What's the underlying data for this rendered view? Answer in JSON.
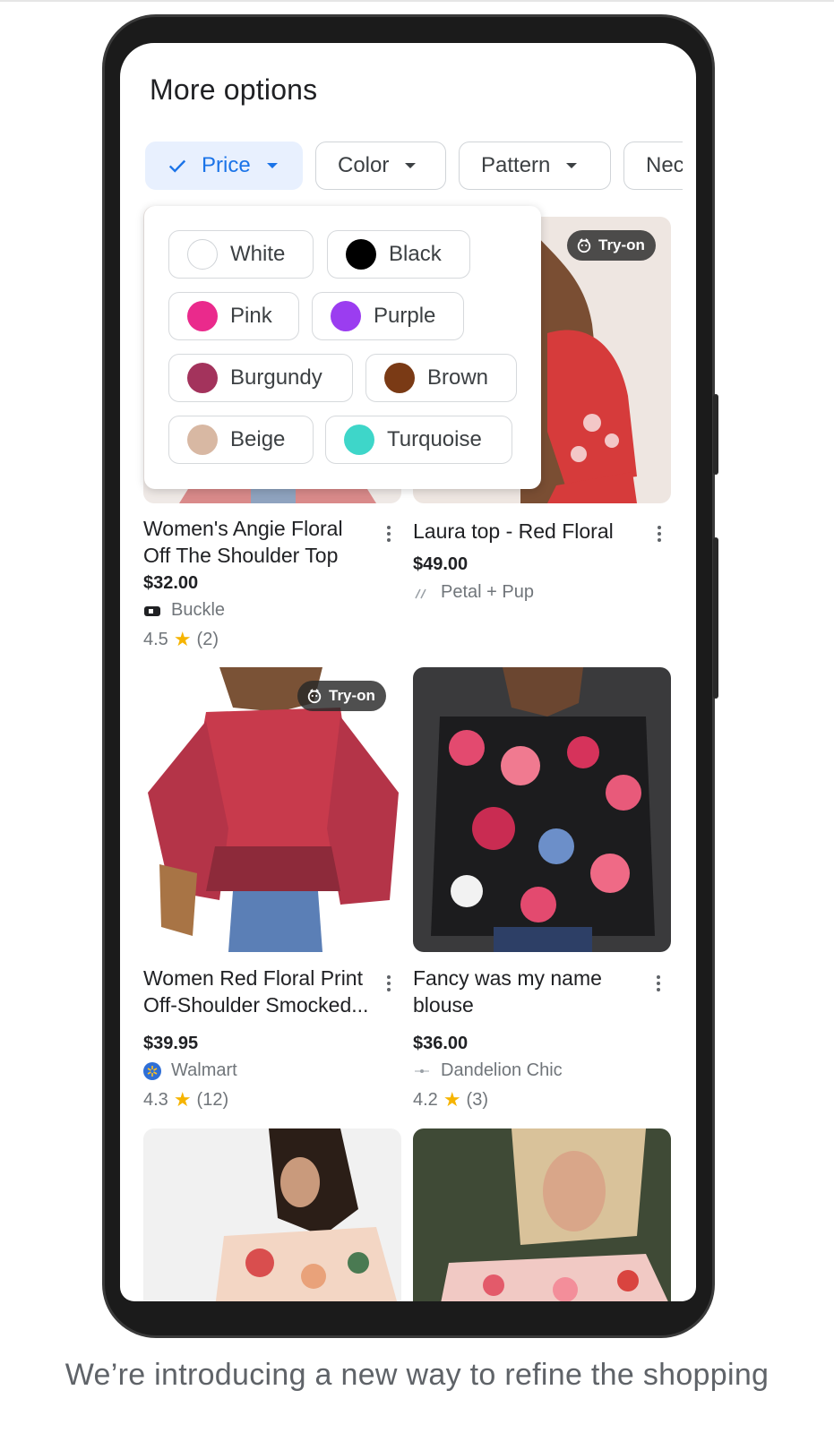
{
  "header": {
    "title": "More options"
  },
  "filters": [
    {
      "label": "Price",
      "active": true
    },
    {
      "label": "Color",
      "active": false
    },
    {
      "label": "Pattern",
      "active": false
    },
    {
      "label": "Nec",
      "active": false
    }
  ],
  "color_menu": {
    "options": [
      {
        "label": "White",
        "color": "#ffffff"
      },
      {
        "label": "Black",
        "color": "#000000"
      },
      {
        "label": "Pink",
        "color": "#ea2a8c"
      },
      {
        "label": "Purple",
        "color": "#9b3df0"
      },
      {
        "label": "Burgundy",
        "color": "#a3335c"
      },
      {
        "label": "Brown",
        "color": "#7a3a15"
      },
      {
        "label": "Beige",
        "color": "#d8b8a3"
      },
      {
        "label": "Turquoise",
        "color": "#3ed6c9"
      }
    ]
  },
  "products": [
    {
      "title": "Women's Angie Floral Off The Shoulder Top",
      "price": "$32.00",
      "store": "Buckle",
      "rating": "4.5",
      "reviews": "(2)",
      "tryon": false
    },
    {
      "title": "Laura top - Red Floral",
      "price": "$49.00",
      "store": "Petal + Pup",
      "rating": "",
      "reviews": "",
      "tryon": true,
      "tryon_label": "Try-on"
    },
    {
      "title": "Women Red Floral Print Off-Shoulder Smocked...",
      "price": "$39.95",
      "store": "Walmart",
      "rating": "4.3",
      "reviews": "(12)",
      "tryon": true,
      "tryon_label": "Try-on"
    },
    {
      "title": "Fancy was my name blouse",
      "price": "$36.00",
      "store": "Dandelion Chic",
      "rating": "4.2",
      "reviews": "(3)",
      "tryon": false
    }
  ],
  "caption": "We’re introducing a new way to refine the shopping",
  "colors": {
    "accent": "#1a73e8",
    "chip_active_bg": "#e8f0fe",
    "star": "#f6b400"
  }
}
